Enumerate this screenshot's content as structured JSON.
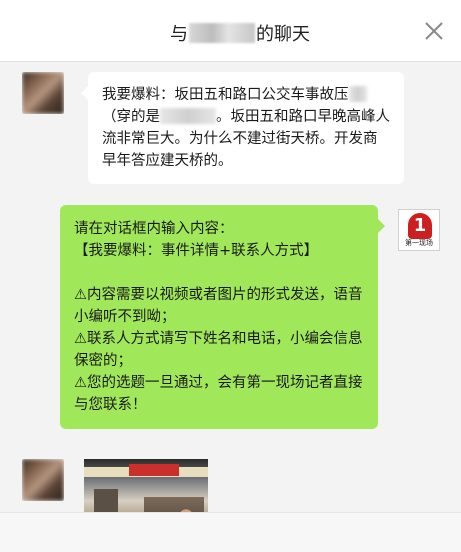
{
  "window": {
    "title_prefix": "与",
    "title_suffix": "的聊天",
    "close_label": "关闭"
  },
  "messages": {
    "incoming_text": {
      "part1": "我要爆料：坂田五和路口公交车事故压",
      "part2": "（穿的是",
      "part3": "。坂田五和路口早晚高峰人流非常巨大。为什么不建过街天桥。开发商早年答应建天桥的。"
    },
    "outgoing_text": [
      "请在对话框内输入内容：",
      "【我要爆料：事件详情+联系人方式】",
      "",
      "⚠内容需要以视频或者图片的形式发送，语音小编听不到呦；",
      "⚠联系人方式请写下姓名和电话，小编会信息保密的；",
      "⚠您的选题一旦通过，会有第一现场记者直接与您联系！"
    ]
  },
  "brand": {
    "logo_glyph": "1",
    "logo_text": "第一现场",
    "accent": "#cc1f1f"
  },
  "colors": {
    "outgoing_bubble": "#a0e75a",
    "incoming_bubble": "#ffffff",
    "chat_background": "#f3f3f3"
  }
}
